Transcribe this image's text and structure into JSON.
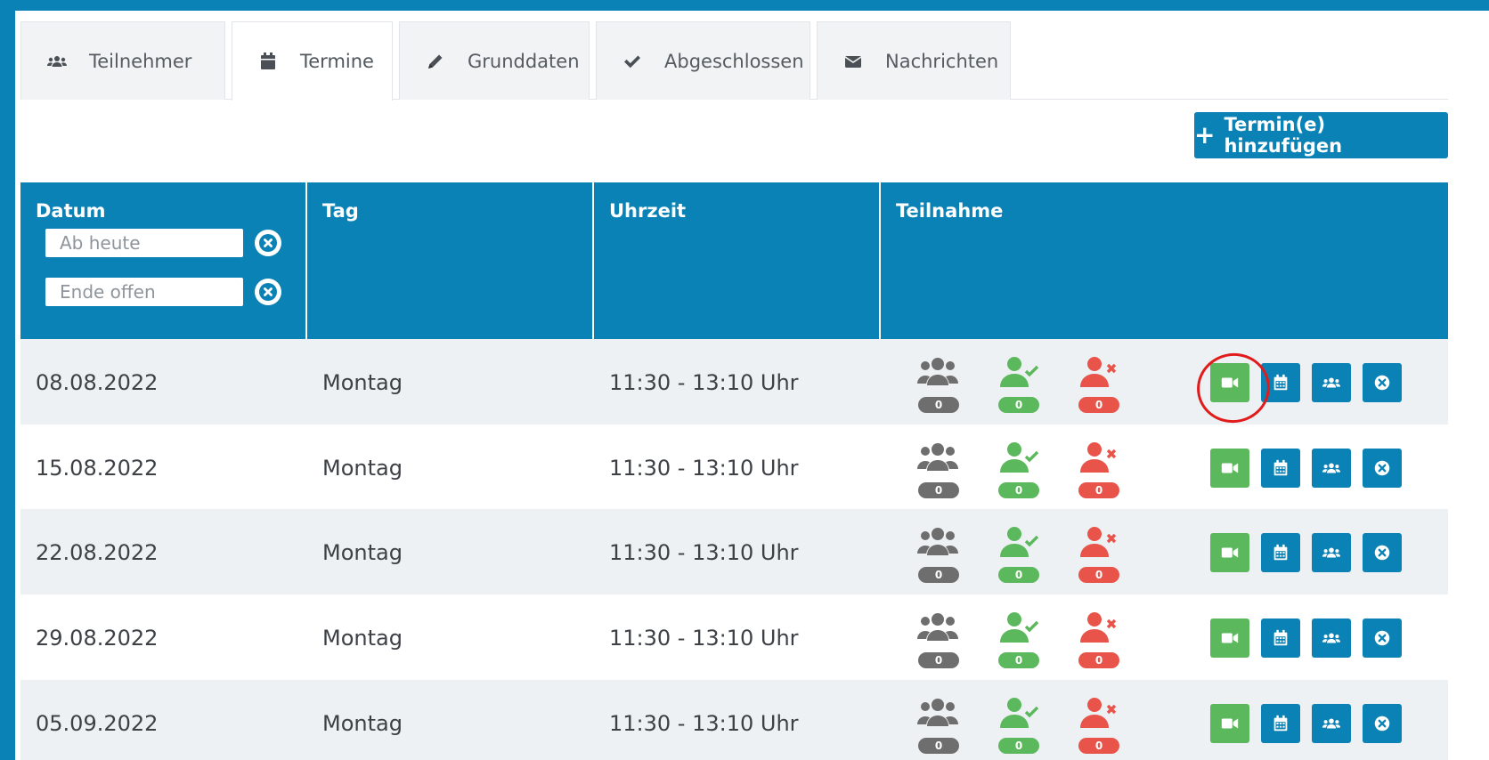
{
  "tabs": [
    {
      "label": "Teilnehmer",
      "icon": "users-icon"
    },
    {
      "label": "Termine",
      "icon": "calendar-icon",
      "active": true
    },
    {
      "label": "Grunddaten",
      "icon": "pencil-icon"
    },
    {
      "label": "Abgeschlossen",
      "icon": "check-icon"
    },
    {
      "label": "Nachrichten",
      "icon": "envelope-icon"
    }
  ],
  "add_button": {
    "label": "Termin(e) hinzufügen",
    "icon": "plus-icon"
  },
  "table": {
    "headers": {
      "datum": "Datum",
      "tag": "Tag",
      "uhrzeit": "Uhrzeit",
      "teilnahme": "Teilnahme"
    },
    "filters": {
      "from_placeholder": "Ab heute",
      "to_placeholder": "Ende offen"
    },
    "rows": [
      {
        "datum": "08.08.2022",
        "tag": "Montag",
        "uhrzeit": "11:30 - 13:10 Uhr",
        "total": "0",
        "present": "0",
        "absent": "0"
      },
      {
        "datum": "15.08.2022",
        "tag": "Montag",
        "uhrzeit": "11:30 - 13:10 Uhr",
        "total": "0",
        "present": "0",
        "absent": "0"
      },
      {
        "datum": "22.08.2022",
        "tag": "Montag",
        "uhrzeit": "11:30 - 13:10 Uhr",
        "total": "0",
        "present": "0",
        "absent": "0"
      },
      {
        "datum": "29.08.2022",
        "tag": "Montag",
        "uhrzeit": "11:30 - 13:10 Uhr",
        "total": "0",
        "present": "0",
        "absent": "0"
      },
      {
        "datum": "05.09.2022",
        "tag": "Montag",
        "uhrzeit": "11:30 - 13:10 Uhr",
        "total": "0",
        "present": "0",
        "absent": "0"
      }
    ]
  },
  "row_actions": [
    "video-call-icon",
    "calendar-icon",
    "users-icon",
    "close-circle-icon"
  ],
  "colors": {
    "brand_blue": "#0b82b5",
    "green": "#5cb85c",
    "red": "#e8534a",
    "grey": "#6e6e6e",
    "highlight_circle": "#e11b1b"
  }
}
